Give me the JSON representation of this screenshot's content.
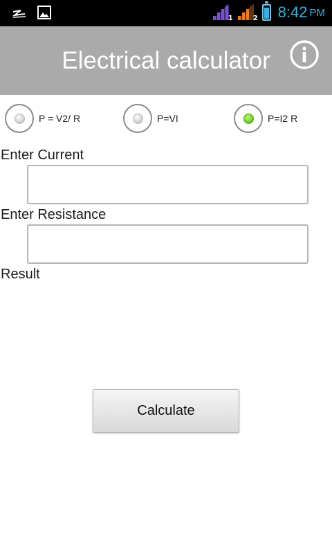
{
  "status_bar": {
    "time": "8:42",
    "ampm": "PM",
    "sim1_label": "1",
    "sim2_label": "2",
    "colors": {
      "background": "#000000",
      "clock": "#33b5e5",
      "signal1": "#7b52d6",
      "signal2": "#f07820"
    }
  },
  "header": {
    "title": "Electrical calculator",
    "background": "#aaaaaa"
  },
  "formulas": [
    {
      "label": "P = V2/ R",
      "selected": false
    },
    {
      "label": "P=VI",
      "selected": false
    },
    {
      "label": "P=I2 R",
      "selected": true
    }
  ],
  "form": {
    "current_label": "Enter Current",
    "current_value": "",
    "resistance_label": "Enter Resistance",
    "resistance_value": "",
    "result_label": "Result"
  },
  "actions": {
    "calculate_label": "Calculate"
  }
}
